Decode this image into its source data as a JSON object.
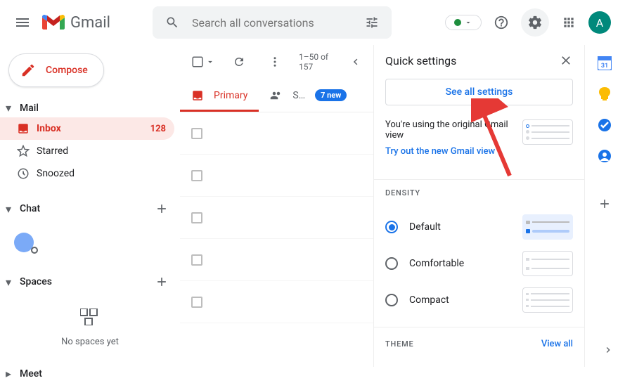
{
  "header": {
    "app_name": "Gmail",
    "search_placeholder": "Search all conversations",
    "avatar_letter": "A"
  },
  "sidebar": {
    "compose_label": "Compose",
    "sections": {
      "mail": "Mail",
      "chat": "Chat",
      "spaces": "Spaces",
      "meet": "Meet"
    },
    "nav": [
      {
        "label": "Inbox",
        "count": "128",
        "active": true
      },
      {
        "label": "Starred"
      },
      {
        "label": "Snoozed"
      }
    ],
    "no_spaces": "No spaces yet"
  },
  "toolbar": {
    "page_info": "1–50 of 157"
  },
  "tabs": [
    {
      "label": "Primary",
      "active": true
    },
    {
      "label": "S…",
      "badge": "7 new"
    }
  ],
  "settings": {
    "title": "Quick settings",
    "see_all": "See all settings",
    "view_notice": "You're using the original Gmail view",
    "try_new": "Try out the new Gmail view",
    "density_label": "DENSITY",
    "density_options": [
      {
        "label": "Default",
        "selected": true
      },
      {
        "label": "Comfortable",
        "selected": false
      },
      {
        "label": "Compact",
        "selected": false
      }
    ],
    "theme_label": "THEME",
    "view_all": "View all"
  }
}
